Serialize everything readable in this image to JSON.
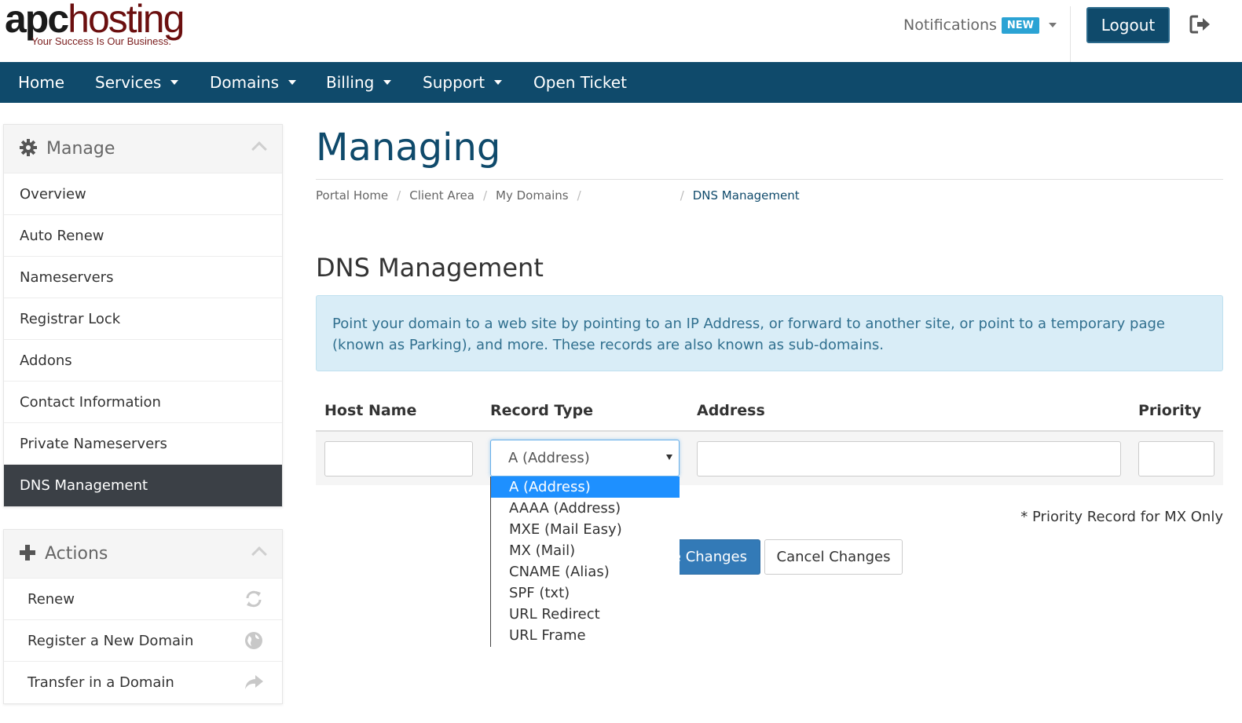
{
  "header": {
    "logo_apc": "apc",
    "logo_hosting": "hosting",
    "logo_tagline": "Your Success Is Our Business.",
    "notifications_label": "Notifications",
    "notifications_badge": "NEW",
    "logout_label": "Logout"
  },
  "nav": {
    "items": [
      {
        "label": "Home"
      },
      {
        "label": "Services"
      },
      {
        "label": "Domains"
      },
      {
        "label": "Billing"
      },
      {
        "label": "Support"
      },
      {
        "label": "Open Ticket"
      }
    ]
  },
  "sidebar": {
    "manage": {
      "title": "Manage",
      "items": [
        {
          "label": "Overview"
        },
        {
          "label": "Auto Renew"
        },
        {
          "label": "Nameservers"
        },
        {
          "label": "Registrar Lock"
        },
        {
          "label": "Addons"
        },
        {
          "label": "Contact Information"
        },
        {
          "label": "Private Nameservers"
        },
        {
          "label": "DNS Management"
        }
      ]
    },
    "actions": {
      "title": "Actions",
      "items": [
        {
          "label": "Renew"
        },
        {
          "label": "Register a New Domain"
        },
        {
          "label": "Transfer in a Domain"
        }
      ]
    }
  },
  "main": {
    "title": "Managing",
    "breadcrumb": {
      "portal_home": "Portal Home",
      "client_area": "Client Area",
      "my_domains": "My Domains",
      "current": "DNS Management"
    },
    "section_title": "DNS Management",
    "info_text": "Point your domain to a web site by pointing to an IP Address, or forward to another site, or point to a temporary page (known as Parking), and more. These records are also known as sub-domains.",
    "table": {
      "headers": {
        "host_name": "Host Name",
        "record_type": "Record Type",
        "address": "Address",
        "priority": "Priority"
      },
      "selected_type": "A (Address)",
      "record_type_options": [
        "A (Address)",
        "AAAA (Address)",
        "MXE (Mail Easy)",
        "MX (Mail)",
        "CNAME (Alias)",
        "SPF (txt)",
        "URL Redirect",
        "URL Frame"
      ]
    },
    "priority_note": "* Priority Record for MX Only",
    "save_label_visible": "e Changes",
    "cancel_label": "Cancel Changes"
  },
  "colors": {
    "brand_navy": "#0f4a6b",
    "badge_blue": "#2ba3d4",
    "info_bg": "#d9edf7",
    "info_text": "#31708f",
    "primary_button": "#337ab7",
    "dropdown_highlight": "#1e90ff",
    "sidebar_active": "#3b4046"
  }
}
